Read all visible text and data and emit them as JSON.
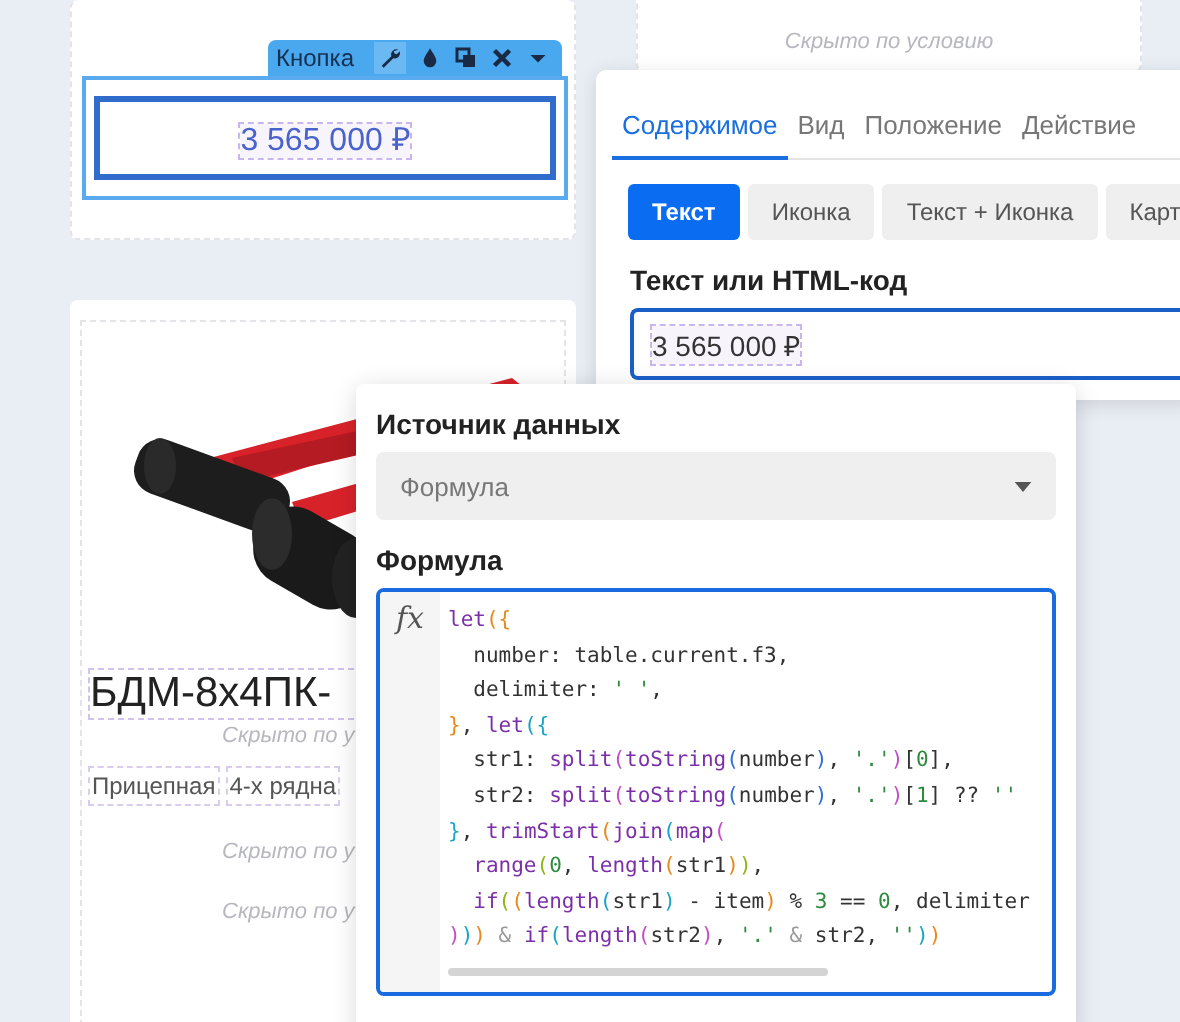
{
  "left_column": {
    "top_card": {
      "toolbar": {
        "label": "Кнопка"
      },
      "button": {
        "label": "3 565 000 ₽"
      }
    },
    "product_card": {
      "image": {
        "kind": "picture"
      },
      "title": "БДМ-8х4ПК-",
      "note": "Скрыто по у",
      "tags": [
        "Прицепная",
        "4-х рядна"
      ],
      "hidden_notes": [
        "Скрыто по у",
        "Скрыто по у"
      ]
    }
  },
  "right_column": {
    "top_card": {
      "hidden_note": "Скрыто по условию"
    }
  },
  "settings_panel": {
    "tabs": [
      {
        "label": "Содержимое",
        "selected": true
      },
      {
        "label": "Вид",
        "selected": false
      },
      {
        "label": "Положение",
        "selected": false
      },
      {
        "label": "Действие",
        "selected": false
      }
    ],
    "modes": [
      {
        "label": "Текст",
        "selected": true
      },
      {
        "label": "Иконка",
        "selected": false
      },
      {
        "label": "Текст + Иконка",
        "selected": false
      },
      {
        "label": "Карт",
        "selected": false
      }
    ],
    "field": {
      "label": "Текст или HTML-код",
      "value": "3 565 000 ₽"
    }
  },
  "formula_panel": {
    "source_label": "Источник данных",
    "source": {
      "value": "Формула"
    },
    "formula_label": "Формула",
    "function_symbol": "fx",
    "code": [
      [
        {
          "text": "let",
          "kind": "func"
        },
        {
          "text": "({",
          "kind": "outer"
        }
      ],
      [
        {
          "text": "  number: table.current.f3,",
          "kind": "plain"
        }
      ],
      [
        {
          "text": "  delimiter: ",
          "kind": "plain"
        },
        {
          "text": "' '",
          "kind": "string"
        },
        {
          "text": ",",
          "kind": "plain"
        }
      ],
      [
        {
          "text": "}",
          "kind": "outer"
        },
        {
          "text": ", ",
          "kind": "plain"
        },
        {
          "text": "let",
          "kind": "func"
        },
        {
          "text": "({",
          "kind": "middle"
        }
      ],
      [
        {
          "text": "  str1: ",
          "kind": "plain"
        },
        {
          "text": "split",
          "kind": "func"
        },
        {
          "text": "(",
          "kind": "inner"
        },
        {
          "text": "toString",
          "kind": "func"
        },
        {
          "text": "(",
          "kind": "deep"
        },
        {
          "text": "number",
          "kind": "plain"
        },
        {
          "text": ")",
          "kind": "deep"
        },
        {
          "text": ", ",
          "kind": "plain"
        },
        {
          "text": "'.'",
          "kind": "string"
        },
        {
          "text": ")",
          "kind": "inner"
        },
        {
          "text": "[",
          "kind": "plain"
        },
        {
          "text": "0",
          "kind": "number"
        },
        {
          "text": "],",
          "kind": "plain"
        }
      ],
      [
        {
          "text": "  str2: ",
          "kind": "plain"
        },
        {
          "text": "split",
          "kind": "func"
        },
        {
          "text": "(",
          "kind": "inner"
        },
        {
          "text": "toString",
          "kind": "func"
        },
        {
          "text": "(",
          "kind": "deep"
        },
        {
          "text": "number",
          "kind": "plain"
        },
        {
          "text": ")",
          "kind": "deep"
        },
        {
          "text": ", ",
          "kind": "plain"
        },
        {
          "text": "'.'",
          "kind": "string"
        },
        {
          "text": ")",
          "kind": "inner"
        },
        {
          "text": "[",
          "kind": "plain"
        },
        {
          "text": "1",
          "kind": "number"
        },
        {
          "text": "] ?? ",
          "kind": "plain"
        },
        {
          "text": "''",
          "kind": "string"
        }
      ],
      [
        {
          "text": "}",
          "kind": "middle"
        },
        {
          "text": ", ",
          "kind": "plain"
        },
        {
          "text": "trimStart",
          "kind": "func"
        },
        {
          "text": "(",
          "kind": "outer"
        },
        {
          "text": "join",
          "kind": "func"
        },
        {
          "text": "(",
          "kind": "middle"
        },
        {
          "text": "map",
          "kind": "func"
        },
        {
          "text": "(",
          "kind": "inner"
        }
      ],
      [
        {
          "text": "  range",
          "kind": "func"
        },
        {
          "text": "(",
          "kind": "extra"
        },
        {
          "text": "0",
          "kind": "number"
        },
        {
          "text": ", ",
          "kind": "plain"
        },
        {
          "text": "length",
          "kind": "func"
        },
        {
          "text": "(",
          "kind": "outer"
        },
        {
          "text": "str1",
          "kind": "plain"
        },
        {
          "text": ")",
          "kind": "outer"
        },
        {
          "text": ")",
          "kind": "extra"
        },
        {
          "text": ",",
          "kind": "plain"
        }
      ],
      [
        {
          "text": "  if",
          "kind": "func"
        },
        {
          "text": "(",
          "kind": "extra"
        },
        {
          "text": "(",
          "kind": "outer"
        },
        {
          "text": "length",
          "kind": "func"
        },
        {
          "text": "(",
          "kind": "middle"
        },
        {
          "text": "str1",
          "kind": "plain"
        },
        {
          "text": ")",
          "kind": "middle"
        },
        {
          "text": " - item",
          "kind": "plain"
        },
        {
          "text": ")",
          "kind": "outer"
        },
        {
          "text": " % ",
          "kind": "plain"
        },
        {
          "text": "3",
          "kind": "number"
        },
        {
          "text": " == ",
          "kind": "plain"
        },
        {
          "text": "0",
          "kind": "number"
        },
        {
          "text": ", delimiter",
          "kind": "plain"
        }
      ],
      [
        {
          "text": ")",
          "kind": "inner"
        },
        {
          "text": ")",
          "kind": "middle"
        },
        {
          "text": ")",
          "kind": "outer"
        },
        {
          "text": " & ",
          "kind": "op"
        },
        {
          "text": "if",
          "kind": "func"
        },
        {
          "text": "(",
          "kind": "middle"
        },
        {
          "text": "length",
          "kind": "func"
        },
        {
          "text": "(",
          "kind": "inner"
        },
        {
          "text": "str2",
          "kind": "plain"
        },
        {
          "text": ")",
          "kind": "inner"
        },
        {
          "text": ", ",
          "kind": "plain"
        },
        {
          "text": "'.'",
          "kind": "string"
        },
        {
          "text": " & ",
          "kind": "op"
        },
        {
          "text": "str2, ",
          "kind": "plain"
        },
        {
          "text": "''",
          "kind": "string"
        },
        {
          "text": ")",
          "kind": "middle"
        },
        {
          "text": ")",
          "kind": "outer"
        }
      ]
    ]
  }
}
